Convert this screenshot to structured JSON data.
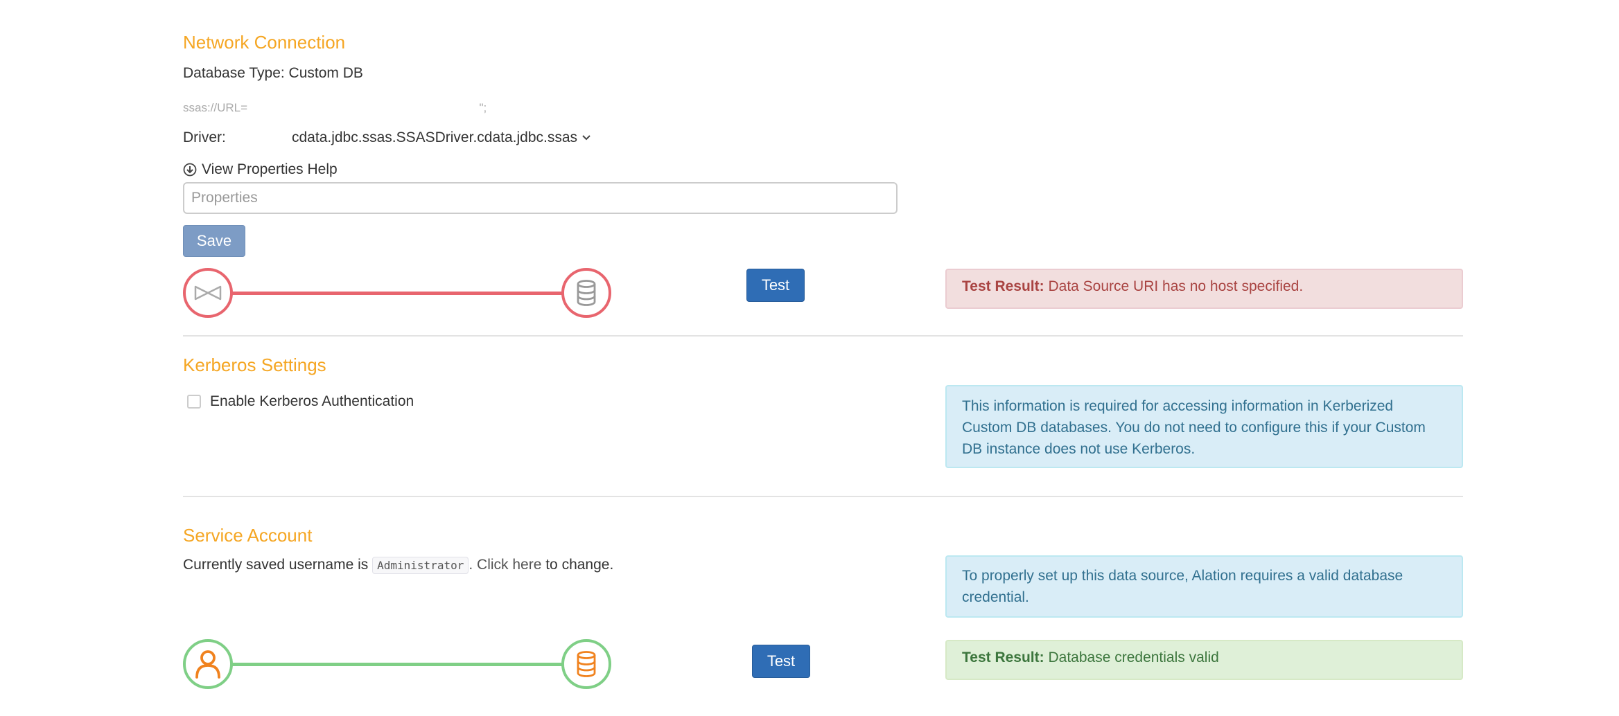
{
  "network": {
    "title": "Network Connection",
    "db_type": "Database Type: Custom DB",
    "uri_prefix": "ssas://URL=",
    "uri_suffix": "\";",
    "driver_label": "Driver:",
    "driver_value": "cdata.jdbc.ssas.SSASDriver.cdata.jdbc.ssas",
    "view_props_help": "View Properties Help",
    "properties_placeholder": "Properties",
    "save_label": "Save",
    "test_label": "Test",
    "result_label": "Test Result:",
    "result_text": "Data Source URI has no host specified.",
    "status_color": "#e8656e"
  },
  "kerberos": {
    "title": "Kerberos Settings",
    "checkbox_label": "Enable Kerberos Authentication",
    "checked": false,
    "info": "This information is required for accessing information in Kerberized Custom DB databases. You do not need to configure this if your Custom DB instance does not use Kerberos."
  },
  "service": {
    "title": "Service Account",
    "saved_prefix": "Currently saved username is",
    "username": "Administrator",
    "click_here": ". Click here",
    "to_change": " to change.",
    "info": "To properly set up this data source, Alation requires a valid database credential.",
    "test_label": "Test",
    "result_label": "Test Result:",
    "result_text": "Database credentials valid",
    "status_color": "#7fcf86",
    "icon_color": "#f0821e"
  },
  "icons": {
    "connector": "bowtie-connector-icon",
    "database": "database-icon",
    "user": "user-icon",
    "arrow": "circle-arrow-down-icon",
    "chevron": "chevron-down-icon"
  }
}
